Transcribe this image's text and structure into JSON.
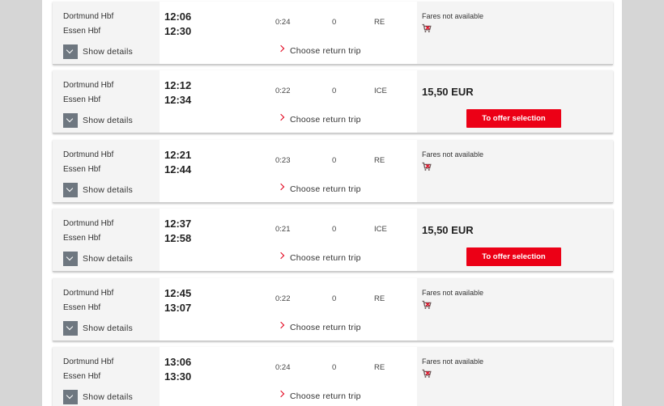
{
  "labels": {
    "show_details": "Show details",
    "choose_return": "Choose return trip",
    "fares_na": "Fares not available",
    "offer_button": "To offer selection"
  },
  "connections": [
    {
      "from": "Dortmund Hbf",
      "to": "Essen Hbf",
      "dep": "12:06",
      "arr": "12:30",
      "duration": "0:24",
      "changes": "0",
      "product": "RE",
      "price": null
    },
    {
      "from": "Dortmund Hbf",
      "to": "Essen Hbf",
      "dep": "12:12",
      "arr": "12:34",
      "duration": "0:22",
      "changes": "0",
      "product": "ICE",
      "price": "15,50 EUR"
    },
    {
      "from": "Dortmund Hbf",
      "to": "Essen Hbf",
      "dep": "12:21",
      "arr": "12:44",
      "duration": "0:23",
      "changes": "0",
      "product": "RE",
      "price": null
    },
    {
      "from": "Dortmund Hbf",
      "to": "Essen Hbf",
      "dep": "12:37",
      "arr": "12:58",
      "duration": "0:21",
      "changes": "0",
      "product": "ICE",
      "price": "15,50 EUR"
    },
    {
      "from": "Dortmund Hbf",
      "to": "Essen Hbf",
      "dep": "12:45",
      "arr": "13:07",
      "duration": "0:22",
      "changes": "0",
      "product": "RE",
      "price": null
    },
    {
      "from": "Dortmund Hbf",
      "to": "Essen Hbf",
      "dep": "13:06",
      "arr": "13:30",
      "duration": "0:24",
      "changes": "0",
      "product": "RE",
      "price": null
    }
  ],
  "colors": {
    "accent": "#ec0016",
    "button_bg": "#6e7780"
  },
  "icons": {
    "cart": "shopping-cart-unavailable-icon",
    "details": "chevron-down-icon",
    "return": "chevron-right-icon"
  }
}
